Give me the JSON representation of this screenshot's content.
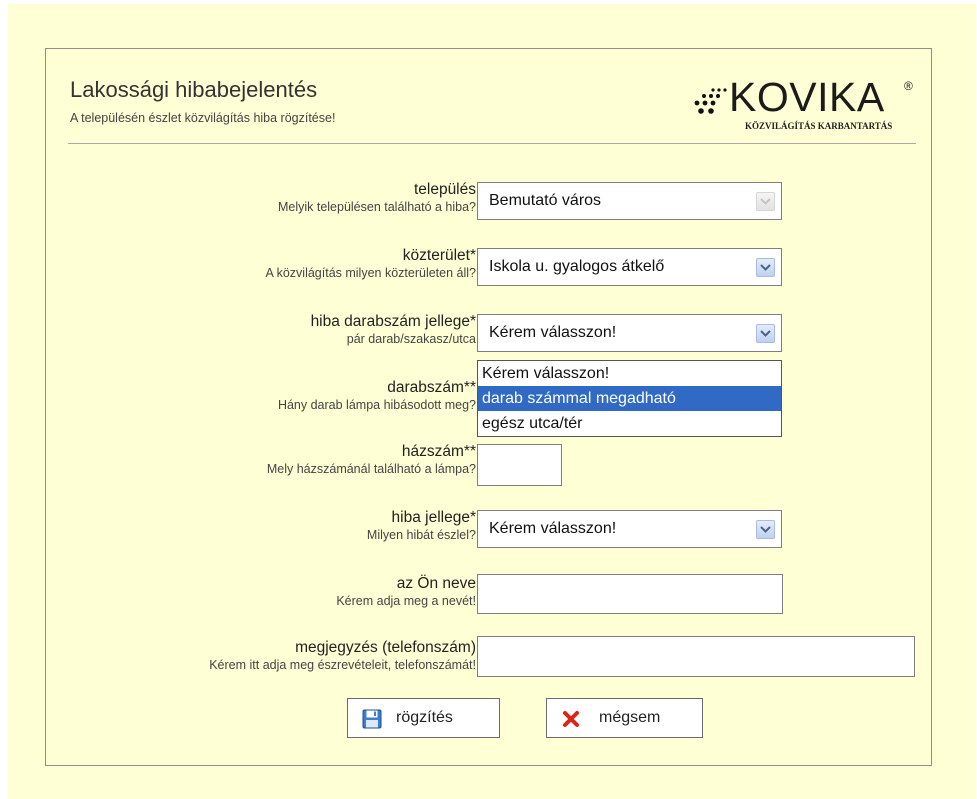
{
  "header": {
    "title": "Lakossági hibabejelentés",
    "subtitle": "A településén észlet közvilágítás hiba rögzítése!",
    "logo_text": "KOVIKA",
    "logo_reg": "®",
    "logo_tagline": "KÖZVILÁGÍTÁS KARBANTARTÁS"
  },
  "fields": {
    "telepules": {
      "label": "település",
      "hint": "Melyik településen található a hiba?",
      "value": "Bemutató város"
    },
    "kozterulet": {
      "label": "közterület*",
      "hint": "A közvilágítás milyen közterületen áll?",
      "value": "Iskola u. gyalogos átkelő"
    },
    "hiba_darab": {
      "label": "hiba darabszám jellege*",
      "hint": "pár darab/szakasz/utca",
      "value": "Kérem válasszon!"
    },
    "darabszam": {
      "label": "darabszám**",
      "hint": "Hány darab lámpa hibásodott meg?"
    },
    "hazszam": {
      "label": "házszám**",
      "hint": "Mely házszámánál található a lámpa?"
    },
    "hiba_jellege": {
      "label": "hiba jellege*",
      "hint": "Milyen hibát észlel?",
      "value": "Kérem válasszon!"
    },
    "nev": {
      "label": "az Ön neve",
      "hint": "Kérem adja meg a nevét!"
    },
    "megjegyzes": {
      "label": "megjegyzés (telefonszám)",
      "hint": "Kérem itt adja meg észrevételeit, telefonszámát!"
    }
  },
  "dropdown_options": [
    "Kérem válasszon!",
    "darab számmal megadható",
    "egész utca/tér"
  ],
  "selected_option_index": 1,
  "buttons": {
    "save": "rögzítés",
    "cancel": "mégsem"
  },
  "colors": {
    "background": "#ffffd5",
    "highlight": "#316ac5"
  }
}
